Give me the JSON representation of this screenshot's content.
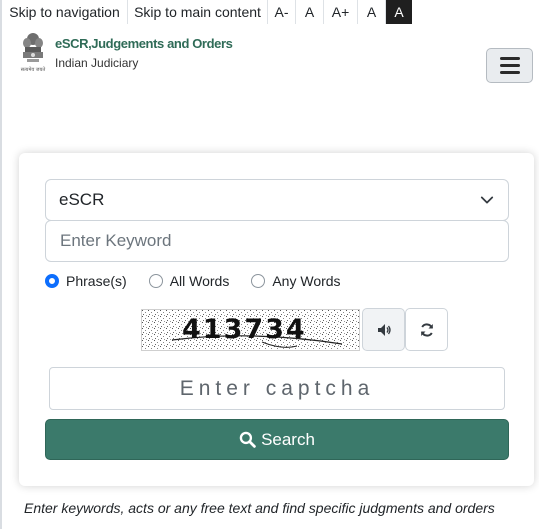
{
  "accessibility_bar": {
    "skip_navigation": "Skip to navigation",
    "skip_main": "Skip to main content",
    "font_decrease": "A-",
    "font_normal": "A",
    "font_increase": "A+",
    "theme_light": "A",
    "theme_dark": "A"
  },
  "header": {
    "title": "eSCR,Judgements and Orders",
    "subtitle": "Indian Judiciary",
    "logo_icon": "national-emblem-icon",
    "menu_icon": "hamburger-icon"
  },
  "search_form": {
    "source_select": {
      "selected": "eSCR",
      "icon": "chevron-down-icon"
    },
    "keyword": {
      "placeholder": "Enter Keyword",
      "value": ""
    },
    "match_options": [
      {
        "label": "Phrase(s)",
        "checked": true
      },
      {
        "label": "All Words",
        "checked": false
      },
      {
        "label": "Any Words",
        "checked": false
      }
    ],
    "captcha": {
      "code": "413734",
      "audio_icon": "speaker-icon",
      "refresh_icon": "refresh-icon",
      "placeholder": "Enter captcha"
    },
    "search_button": {
      "label": "Search",
      "icon": "search-icon",
      "color": "#3b7a6b"
    }
  },
  "footer_note": "Enter keywords, acts or any free text and find specific judgments and orders",
  "colors": {
    "accent": "#3b7a6b",
    "title": "#2f6b57",
    "radio": "#0d6efd"
  }
}
